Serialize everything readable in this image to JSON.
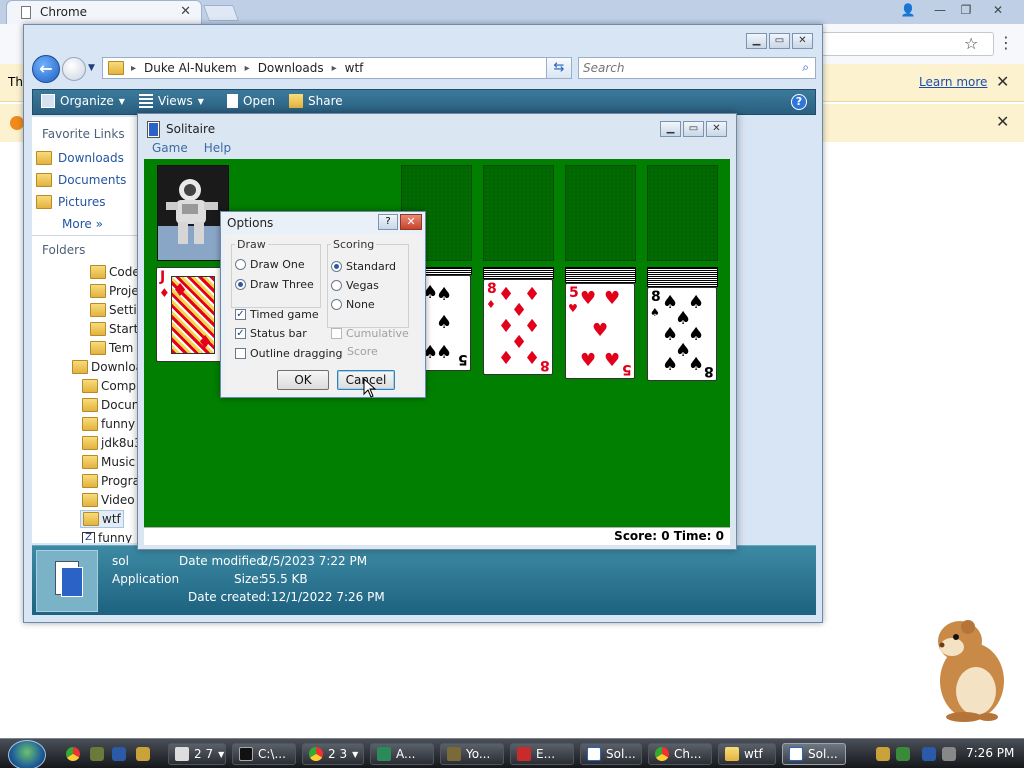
{
  "chrome": {
    "tab_title": "Chrome",
    "infobar_prefix": "Th",
    "learn_more": "Learn more"
  },
  "explorer": {
    "breadcrumb": [
      "Duke Al-Nukem",
      "Downloads",
      "wtf"
    ],
    "search_placeholder": "Search",
    "commands": {
      "organize": "Organize",
      "views": "Views",
      "open": "Open",
      "share": "Share"
    },
    "nav": {
      "favorite_links": "Favorite Links",
      "favorites": [
        "Downloads",
        "Documents",
        "Pictures"
      ],
      "more": "More",
      "folders": "Folders",
      "tree": [
        "Code",
        "Proje",
        "Setti",
        "Start",
        "Tem",
        "Downloa",
        "Comp",
        "Docun",
        "funny",
        "jdk8u3",
        "Music",
        "Progra",
        "Video",
        "wtf",
        "funny"
      ]
    },
    "details": {
      "name": "sol",
      "type": "Application",
      "modified_label": "Date modified:",
      "modified_value": "2/5/2023 7:22 PM",
      "size_label": "Size:",
      "size_value": "55.5 KB",
      "created_label": "Date created:",
      "created_value": "12/1/2022 7:26 PM"
    }
  },
  "solitaire": {
    "title": "Solitaire",
    "menu": [
      "Game",
      "Help"
    ],
    "status": "Score: 0 Time: 0",
    "cards": {
      "waste_rank": "J",
      "t4_rank": "5",
      "t5_rank": "8",
      "t6_rank": "5",
      "t7_rank": "8"
    }
  },
  "options_dialog": {
    "title": "Options",
    "help": "?",
    "draw_label": "Draw",
    "draw_one": "Draw One",
    "draw_three": "Draw Three",
    "draw_selected": "Draw Three",
    "scoring_label": "Scoring",
    "standard": "Standard",
    "vegas": "Vegas",
    "none": "None",
    "scoring_selected": "Standard",
    "timed_game": "Timed game",
    "timed_checked": true,
    "status_bar": "Status bar",
    "status_checked": true,
    "outline_dragging": "Outline dragging",
    "outline_checked": false,
    "cumulative": "Cumulative",
    "cumulative_score": "Score",
    "cumulative_checked": false,
    "ok": "OK",
    "cancel": "Cancel"
  },
  "taskbar": {
    "tasks": [
      "2 7",
      "C:\\...",
      "2 3",
      "A...",
      "Yo...",
      "E...",
      "Sol...",
      "Ch...",
      "wtf",
      "Sol..."
    ],
    "clock": "7:26 PM"
  },
  "colors": {
    "felt": "#007f00",
    "card_red": "#e3001b",
    "explorer_cmd_bar": "#2a5f80",
    "infobar": "#fcf2cf"
  }
}
